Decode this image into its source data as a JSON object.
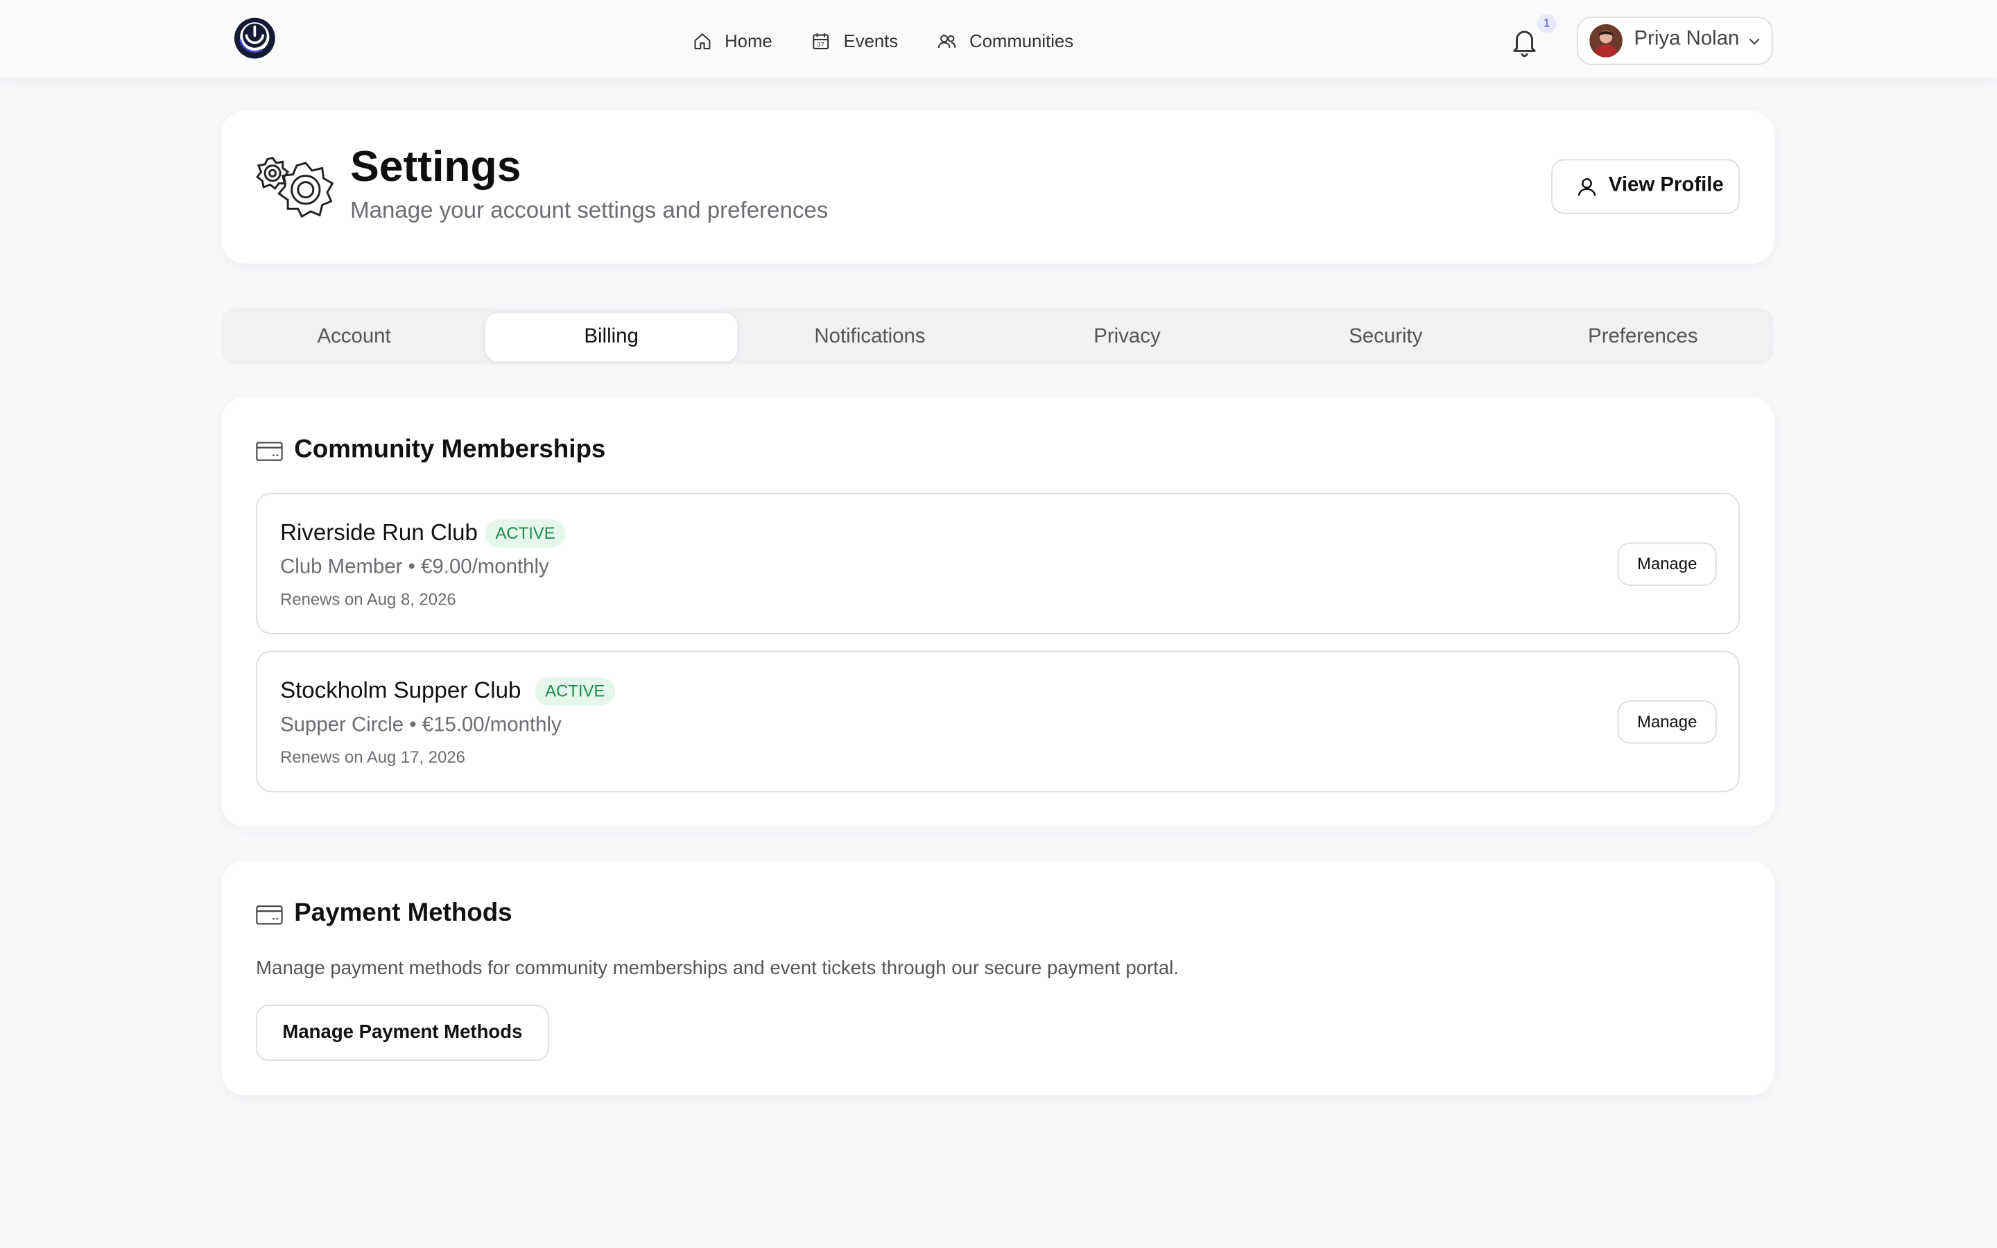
{
  "nav": {
    "items": [
      {
        "label": "Home",
        "icon": "home-icon"
      },
      {
        "label": "Events",
        "icon": "calendar-icon"
      },
      {
        "label": "Communities",
        "icon": "users-icon"
      }
    ],
    "notifications_count": "1",
    "user_name": "Priya Nolan"
  },
  "header": {
    "title": "Settings",
    "subtitle": "Manage your account settings and preferences",
    "view_profile_label": "View Profile"
  },
  "tabs": [
    {
      "label": "Account",
      "active": false
    },
    {
      "label": "Billing",
      "active": true
    },
    {
      "label": "Notifications",
      "active": false
    },
    {
      "label": "Privacy",
      "active": false
    },
    {
      "label": "Security",
      "active": false
    },
    {
      "label": "Preferences",
      "active": false
    }
  ],
  "memberships": {
    "title": "Community Memberships",
    "items": [
      {
        "name": "Riverside Run Club",
        "status": "ACTIVE",
        "plan": "Club Member",
        "price": "€9.00/monthly",
        "renewal": "Renews on Aug 8, 2026",
        "button": "Manage"
      },
      {
        "name": "Stockholm Supper Club",
        "status": "ACTIVE",
        "plan": "Supper Circle",
        "price": "€15.00/monthly",
        "renewal": "Renews on Aug 17, 2026",
        "button": "Manage"
      }
    ]
  },
  "payment": {
    "title": "Payment Methods",
    "description": "Manage payment methods for community memberships and event tickets through our secure payment portal.",
    "button": "Manage Payment Methods"
  },
  "colors": {
    "accent": "#4a52d8",
    "active_badge_bg": "#e4f7ea",
    "active_badge_text": "#1b8b48",
    "page_bg": "#f8f8fb"
  }
}
